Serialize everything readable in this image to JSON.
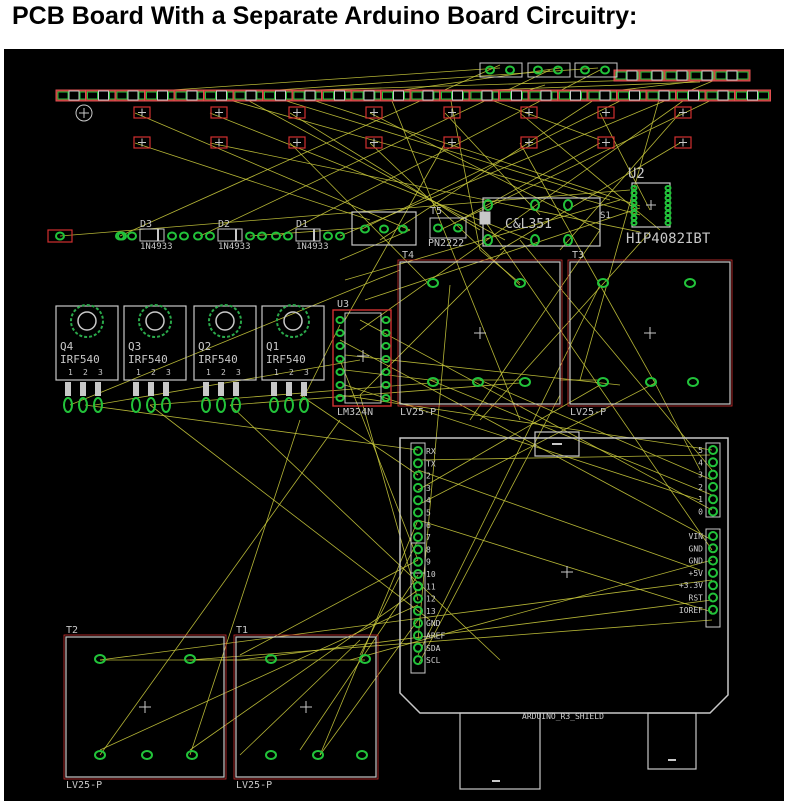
{
  "title": "PCB Board With a Separate Arduino Board Circuitry:",
  "colors": {
    "background": "#000000",
    "airwire": "#c8c83c",
    "pad": "#22c33a",
    "outline": "#c8c8c8",
    "redOutline": "#d03030",
    "resistorBody": "#c03a3a"
  },
  "components": {
    "diodes": [
      "D3",
      "D2",
      "D1"
    ],
    "diodeValue": "1N4933",
    "mosfets": [
      {
        "ref": "Q4",
        "value": "IRF540"
      },
      {
        "ref": "Q3",
        "value": "IRF540"
      },
      {
        "ref": "Q2",
        "value": "IRF540"
      },
      {
        "ref": "Q1",
        "value": "IRF540"
      }
    ],
    "mosfetPins": [
      "1",
      "2",
      "3"
    ],
    "opamp": {
      "ref": "U3",
      "value": "LM324N"
    },
    "transistor": {
      "ref": "T5",
      "value": "PN2222"
    },
    "switch": {
      "ref": "S1",
      "value": "C&L351"
    },
    "driver": {
      "ref": "U2",
      "value": "HIP4082IBT"
    },
    "sensors": [
      {
        "ref": "T4",
        "value": "LV25-P"
      },
      {
        "ref": "T3",
        "value": "LV25-P"
      },
      {
        "ref": "T2",
        "value": "LV25-P"
      },
      {
        "ref": "T1",
        "value": "LV25-P"
      }
    ]
  },
  "arduino": {
    "digitalLeftPins": [
      "RX",
      "TX",
      "2",
      "3",
      "4",
      "5",
      "6",
      "7",
      "8",
      "9",
      "10",
      "11",
      "12",
      "13",
      "GND",
      "AREF",
      "SDA",
      "SCL"
    ],
    "digitalRightPins": [
      "5",
      "4",
      "3",
      "2",
      "1",
      "0"
    ],
    "powerPins": [
      "VIN",
      "GND",
      "GND",
      "+5V",
      "+3.3V",
      "RST",
      "IOREF"
    ],
    "boardLabel": "ARDUINO_R3_SHIELD"
  }
}
